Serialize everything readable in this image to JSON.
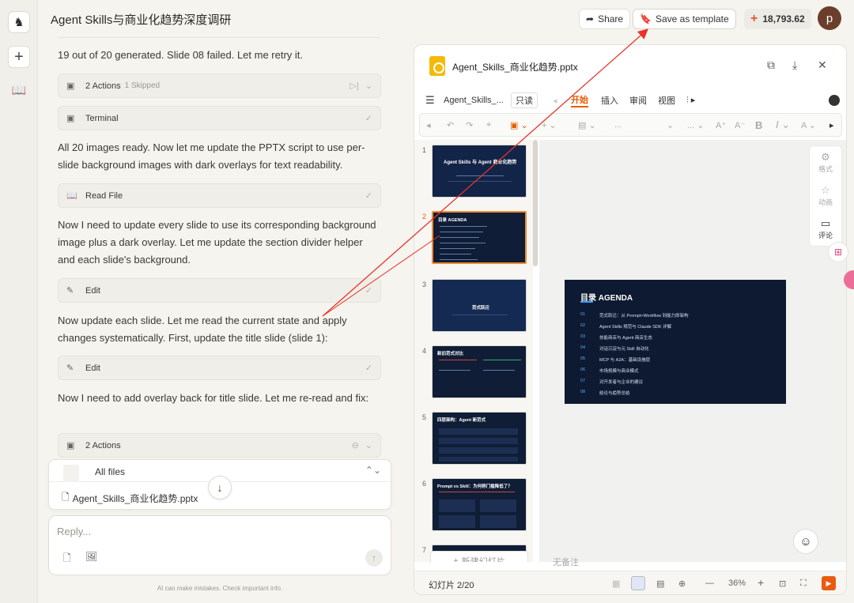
{
  "header": {
    "title": "Agent Skills与商业化趋势深度调研",
    "share_label": "Share",
    "template_label": "Save as template",
    "credits": "18,793.62",
    "avatar_letter": "p"
  },
  "chat": {
    "messages": [
      {
        "text": "19 out of 20 generated. Slide 08 failed. Let me retry it."
      },
      {
        "text": "All 20 images ready. Now let me update the PPTX script to use per-slide background images with dark overlays for text readability."
      },
      {
        "text": "Now I need to update every slide to use its corresponding background image plus a dark overlay. Let me update the section divider helper and each slide's background."
      },
      {
        "text": "Now update each slide. Let me read the current state and apply changes systematically. First, update the title slide (slide 1):"
      },
      {
        "text": "Now I need to add overlay back for title slide. Let me re-read and fix:"
      }
    ],
    "blocks": [
      {
        "label": "2 Actions",
        "sub": "1 Skipped"
      },
      {
        "label": "Terminal",
        "sub": ""
      },
      {
        "label": "Read File",
        "sub": ""
      },
      {
        "label": "Edit",
        "sub": ""
      },
      {
        "label": "Edit",
        "sub": ""
      },
      {
        "label": "2 Actions",
        "sub": ""
      }
    ],
    "files_title": "All files",
    "file_name": "Agent_Skills_商业化趋势.pptx",
    "reply_placeholder": "Reply...",
    "disclaimer": "AI can make mistakes. Check important info."
  },
  "viewer": {
    "file_name": "Agent_Skills_商业化趋势.pptx",
    "menu_file": "Agent_Skills_...",
    "read_only": "只读",
    "menus": [
      "开始",
      "插入",
      "审阅",
      "视图"
    ],
    "side_tools": [
      "格式",
      "动画",
      "评论"
    ],
    "new_slide": "新建幻灯片",
    "notes_placeholder": "无备注",
    "slide_counter": "幻灯片 2/20",
    "zoom": "36%",
    "thumbs": [
      {
        "num": "1",
        "title": "Agent Skills 与 Agent 商业化趋势"
      },
      {
        "num": "2",
        "title": "目录 AGENDA"
      },
      {
        "num": "3",
        "title": "范式跃迁"
      },
      {
        "num": "4",
        "title": "新旧范式对比"
      },
      {
        "num": "5",
        "title": "四层架构：Agent 新范式"
      },
      {
        "num": "6",
        "title": "Prompt vs Skill：为何称门槛降低了？"
      },
      {
        "num": "7",
        "title": ""
      }
    ],
    "slide": {
      "title": "目录 AGENDA",
      "items": [
        {
          "n": "01",
          "t": "范式跃迁：从 Prompt+Workflow 到能力即架构"
        },
        {
          "n": "02",
          "t": "Agent Skills 规范与 Claude SDK 详解"
        },
        {
          "n": "03",
          "t": "技能商店与 Agent 商店生态"
        },
        {
          "n": "04",
          "t": "对话沉淀与元 Skill 自动化"
        },
        {
          "n": "05",
          "t": "MCP 与 A2A：基础设施层"
        },
        {
          "n": "06",
          "t": "市场规模与商业模式"
        },
        {
          "n": "07",
          "t": "对开发者与企业的建议"
        },
        {
          "n": "08",
          "t": "结论与趋势总结"
        }
      ]
    }
  },
  "colors": {
    "accent": "#e65c00",
    "arrow": "#e8332a",
    "slide_bg": "#0d1a31"
  }
}
